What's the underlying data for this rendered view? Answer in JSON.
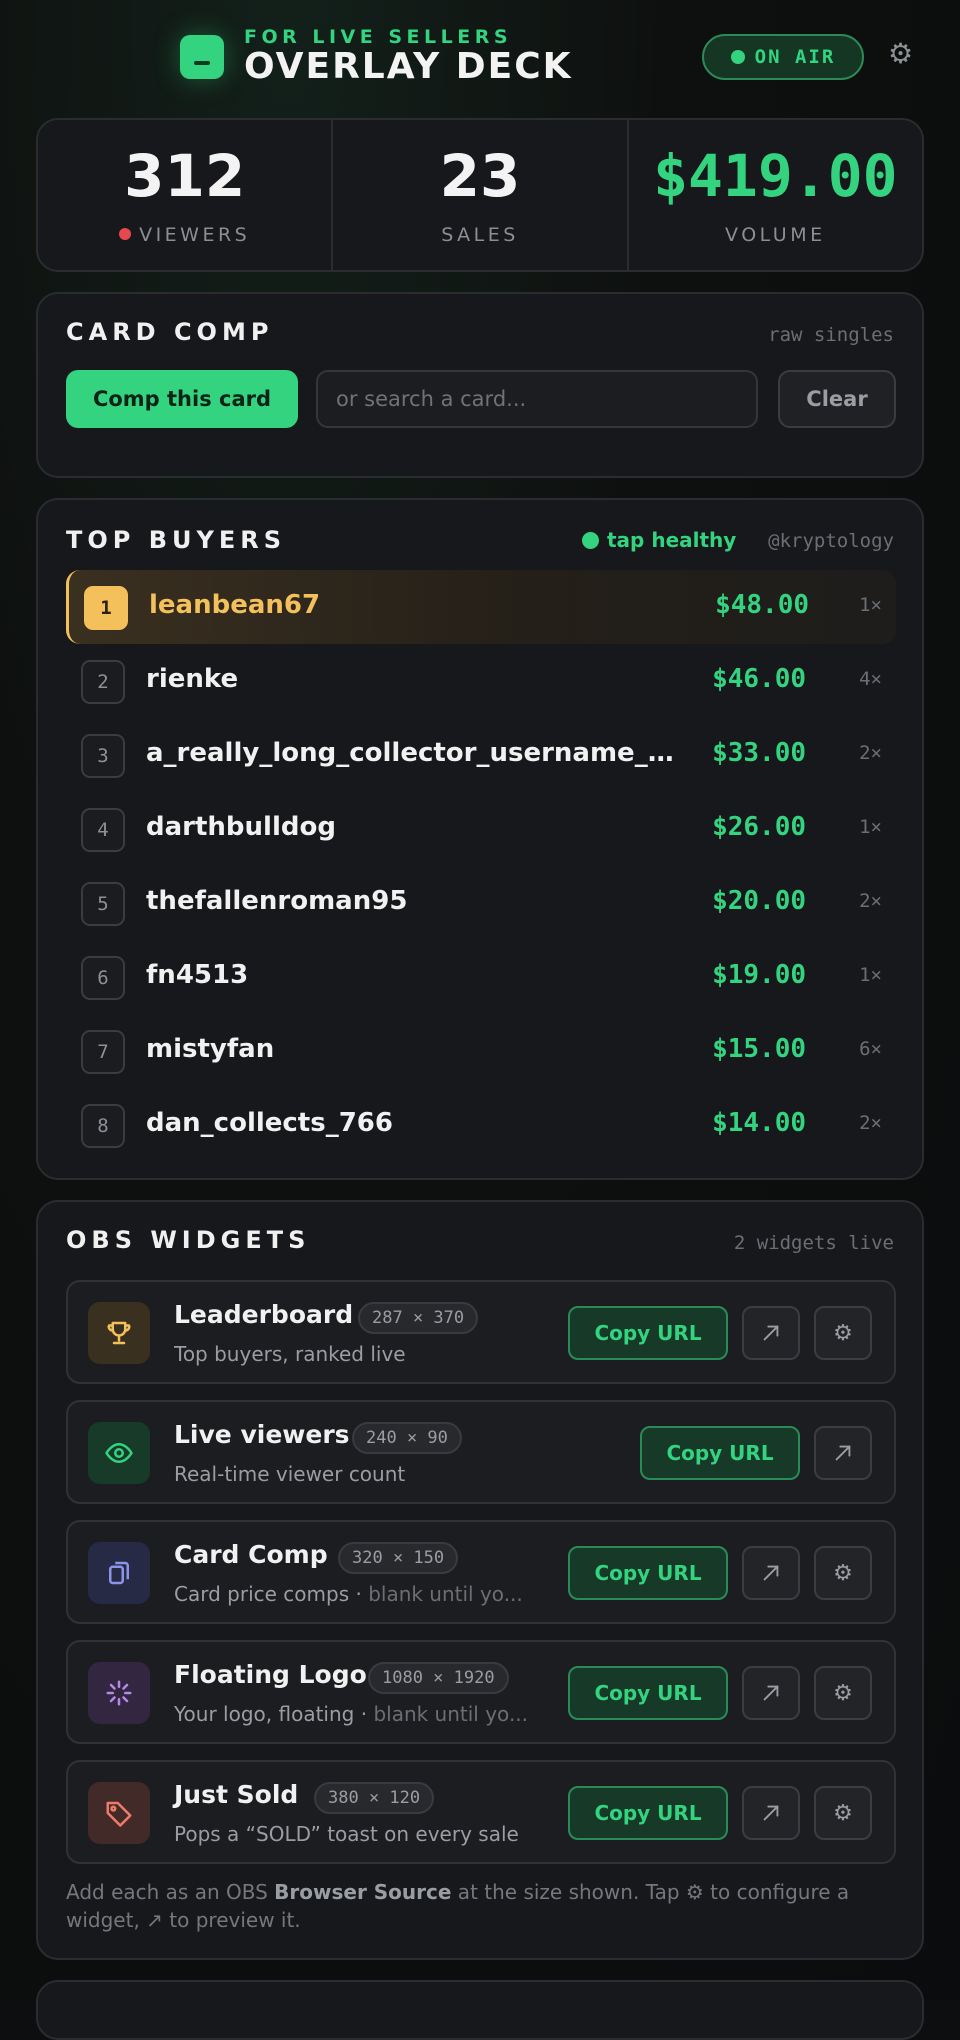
{
  "header": {
    "eyebrow": "FOR LIVE SELLERS",
    "brand": "OVERLAY DECK",
    "status": "ON AIR"
  },
  "stats": [
    {
      "value": "312",
      "label": "VIEWERS"
    },
    {
      "value": "23",
      "label": "SALES"
    },
    {
      "value": "$419.00",
      "label": "VOLUME"
    }
  ],
  "card_comp": {
    "title": "CARD COMP",
    "aside": "raw singles",
    "primary_label": "Comp this card",
    "search_placeholder": "or search a card...",
    "clear_label": "Clear"
  },
  "top_buyers": {
    "title": "TOP BUYERS",
    "tap_status": "tap healthy",
    "handle": "@kryptology",
    "rows": [
      {
        "rank": "1",
        "name": "leanbean67",
        "amount": "$48.00",
        "count": "1×"
      },
      {
        "rank": "2",
        "name": "rienke",
        "amount": "$46.00",
        "count": "4×"
      },
      {
        "rank": "3",
        "name": "a_really_long_collector_username_h...",
        "amount": "$33.00",
        "count": "2×"
      },
      {
        "rank": "4",
        "name": "darthbulldog",
        "amount": "$26.00",
        "count": "1×"
      },
      {
        "rank": "5",
        "name": "thefallenroman95",
        "amount": "$20.00",
        "count": "2×"
      },
      {
        "rank": "6",
        "name": "fn4513",
        "amount": "$19.00",
        "count": "1×"
      },
      {
        "rank": "7",
        "name": "mistyfan",
        "amount": "$15.00",
        "count": "6×"
      },
      {
        "rank": "8",
        "name": "dan_collects_766",
        "amount": "$14.00",
        "count": "2×"
      }
    ]
  },
  "obs_widgets": {
    "title": "OBS WIDGETS",
    "aside": "2 widgets live",
    "copy_label": "Copy URL",
    "items": [
      {
        "title": "Leaderboard",
        "size": "287 × 370",
        "desc": "Top buyers, ranked live",
        "desc_muted": "",
        "icon": "trophy-icon"
      },
      {
        "title": "Live viewers",
        "size": "240 × 90",
        "desc": "Real-time viewer count",
        "desc_muted": "",
        "icon": "eye-icon"
      },
      {
        "title": "Card Comp",
        "size": "320 × 150",
        "desc": "Card price comps · ",
        "desc_muted": "blank until yo...",
        "icon": "cards-icon"
      },
      {
        "title": "Floating Logo",
        "size": "1080 × 1920",
        "desc": "Your logo, floating · ",
        "desc_muted": "blank until yo...",
        "icon": "spinner-icon"
      },
      {
        "title": "Just Sold",
        "size": "380 × 120",
        "desc": "Pops a “SOLD” toast on every sale",
        "desc_muted": "",
        "icon": "tag-icon"
      }
    ],
    "footnote_pre": "Add each as an OBS ",
    "footnote_bold": "Browser Source",
    "footnote_post": " at the size shown. Tap ⚙ to configure a widget, ↗ to preview it."
  },
  "colors": {
    "accent": "#33d37f",
    "gold": "#f3c05b",
    "live_dot": "#e5484d"
  }
}
